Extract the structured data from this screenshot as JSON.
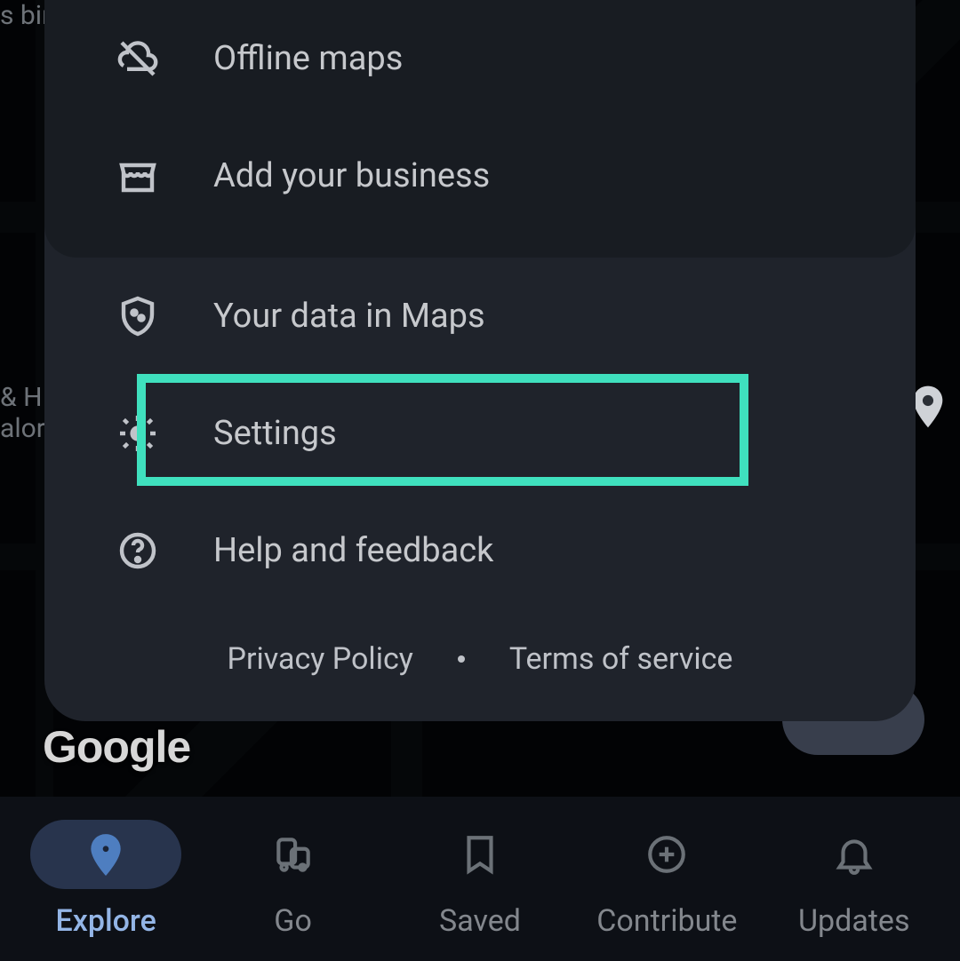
{
  "map": {
    "logo": "Google",
    "bg_text_1": "s bir",
    "bg_text_2": "& H\nalor"
  },
  "menu": {
    "items": [
      {
        "label": "Offline maps",
        "icon": "cloud-off"
      },
      {
        "label": "Add your business",
        "icon": "storefront"
      },
      {
        "label": "Your data in Maps",
        "icon": "shield-privacy"
      },
      {
        "label": "Settings",
        "icon": "gear",
        "highlighted": true
      },
      {
        "label": "Help and feedback",
        "icon": "help-circle"
      }
    ]
  },
  "footer": {
    "privacy": "Privacy Policy",
    "terms": "Terms of service"
  },
  "bottom_nav": {
    "items": [
      {
        "label": "Explore",
        "icon": "pin",
        "active": true
      },
      {
        "label": "Go",
        "icon": "transit",
        "active": false
      },
      {
        "label": "Saved",
        "icon": "bookmark",
        "active": false
      },
      {
        "label": "Contribute",
        "icon": "plus-circle",
        "active": false
      },
      {
        "label": "Updates",
        "icon": "bell",
        "active": false
      }
    ]
  },
  "highlight_color": "#3fe0be"
}
